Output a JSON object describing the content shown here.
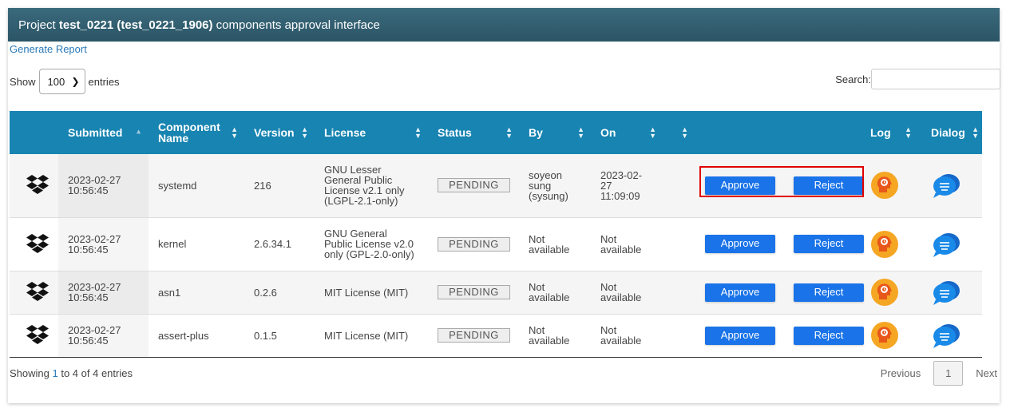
{
  "header": {
    "prefix": "Project ",
    "project": "test_0221 (test_0221_1906)",
    "suffix": " components approval interface"
  },
  "report_link": "Generate Report",
  "length_menu": {
    "show": "Show",
    "value": "100",
    "entries": "entries"
  },
  "search": {
    "label": "Search:",
    "value": ""
  },
  "columns": {
    "submitted": "Submitted",
    "component_name": "Component Name",
    "version": "Version",
    "license": "License",
    "status": "Status",
    "by": "By",
    "on": "On",
    "log": "Log",
    "dialog": "Dialog"
  },
  "rows": [
    {
      "submitted_date": "2023-02-27",
      "submitted_time": "10:56:45",
      "name": "systemd",
      "version": "216",
      "license": "GNU Lesser General Public License v2.1 only (LGPL-2.1-only)",
      "status": "PENDING",
      "by": "soyeon sung (sysung)",
      "on": "2023-02-27 11:09:09",
      "approve": "Approve",
      "reject": "Reject"
    },
    {
      "submitted_date": "2023-02-27",
      "submitted_time": "10:56:45",
      "name": "kernel",
      "version": "2.6.34.1",
      "license": "GNU General Public License v2.0 only (GPL-2.0-only)",
      "status": "PENDING",
      "by": "Not available",
      "on": "Not available",
      "approve": "Approve",
      "reject": "Reject"
    },
    {
      "submitted_date": "2023-02-27",
      "submitted_time": "10:56:45",
      "name": "asn1",
      "version": "0.2.6",
      "license": "MIT License (MIT)",
      "status": "PENDING",
      "by": "Not available",
      "on": "Not available",
      "approve": "Approve",
      "reject": "Reject"
    },
    {
      "submitted_date": "2023-02-27",
      "submitted_time": "10:56:45",
      "name": "assert-plus",
      "version": "0.1.5",
      "license": "MIT License (MIT)",
      "status": "PENDING",
      "by": "Not available",
      "on": "Not available",
      "approve": "Approve",
      "reject": "Reject"
    }
  ],
  "footer": {
    "showing": "Showing ",
    "from": "1",
    "to_word": " to ",
    "to": "4",
    "of_word": " of ",
    "total": "4",
    "entries_word": " entries"
  },
  "pagination": {
    "previous": "Previous",
    "current": "1",
    "next": "Next"
  },
  "icons": {
    "component": "dropbox-icon",
    "log": "log-brain-icon",
    "dialog": "chat-bubble-icon",
    "sort": "sort-arrows-icon"
  },
  "colors": {
    "header_bar": "#2f5b6c",
    "table_header": "#1784b1",
    "button": "#1a73e8",
    "highlight": "#e00000",
    "log_icon": "#f5a623",
    "dialog_icon": "#1a73e8"
  }
}
